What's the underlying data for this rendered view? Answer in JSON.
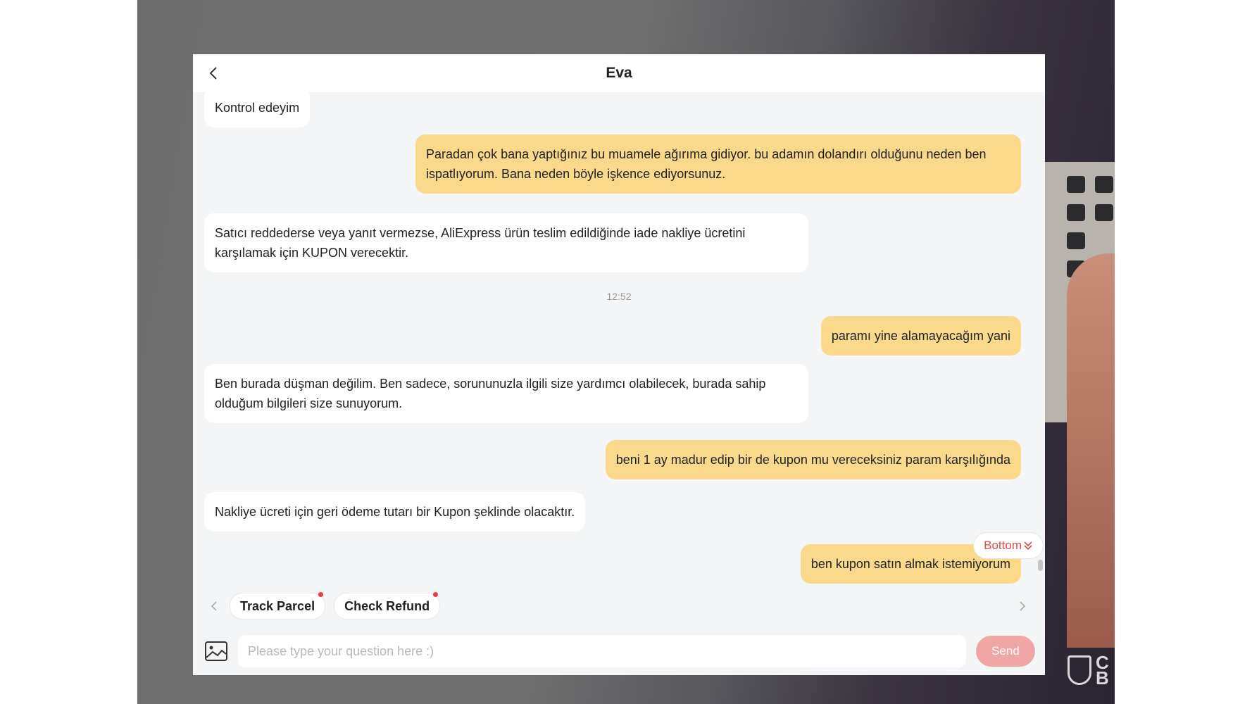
{
  "header": {
    "title": "Eva"
  },
  "messages": [
    {
      "from": "agent",
      "text": "Kontrol edeyim"
    },
    {
      "from": "user",
      "text": "Paradan çok bana yaptığınız bu muamele ağırıma gidiyor. bu adamın dolandırı olduğunu neden ben ispatlıyorum. Bana neden böyle işkence ediyorsunuz."
    },
    {
      "from": "agent",
      "text": "Satıcı reddederse veya yanıt vermezse, AliExpress ürün teslim edildiğinde iade nakliye ücretini karşılamak için KUPON verecektir."
    },
    {
      "from": "user",
      "text": "paramı yine alamayacağım yani"
    },
    {
      "from": "agent",
      "text": "Ben burada düşman değilim. Ben sadece, sorununuzla ilgili size yardımcı olabilecek, burada sahip olduğum bilgileri size sunuyorum."
    },
    {
      "from": "user",
      "text": "beni 1 ay madur edip bir de kupon mu vereceksiniz param karşılığında"
    },
    {
      "from": "agent",
      "text": "Nakliye ücreti için geri ödeme tutarı bir Kupon şeklinde olacaktır."
    },
    {
      "from": "user",
      "text": "ben kupon satın almak istemiyorum"
    }
  ],
  "timestamp": "12:52",
  "bottom_button": {
    "label": "Bottom"
  },
  "quick_actions": [
    {
      "label": "Track Parcel",
      "has_dot": true
    },
    {
      "label": "Check Refund",
      "has_dot": true
    }
  ],
  "input": {
    "placeholder": "Please type your question here :)",
    "value": ""
  },
  "send_label": "Send",
  "watermark": {
    "line1": "C",
    "line2": "B"
  },
  "colors": {
    "user_bubble": "#fbd98b",
    "agent_bubble": "#ffffff",
    "accent": "#e14b4b",
    "send_button": "#f1a6a6"
  }
}
